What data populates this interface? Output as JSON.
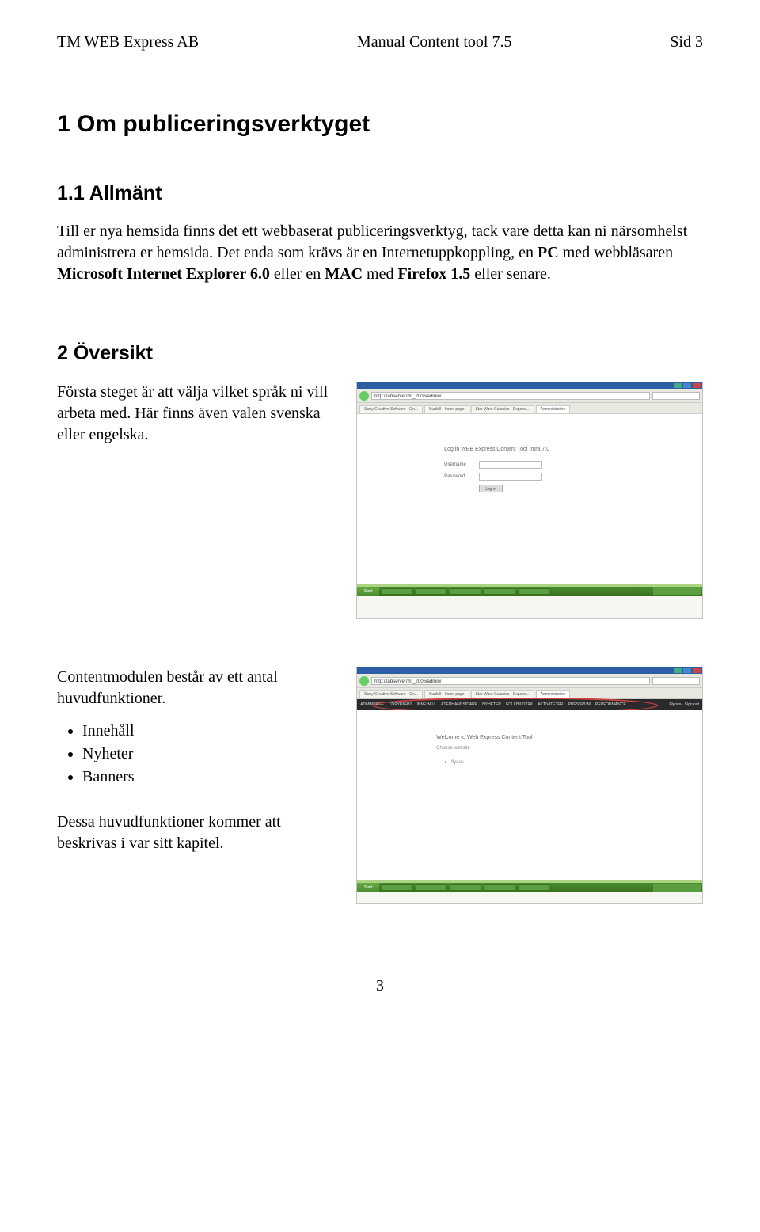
{
  "header": {
    "company": "TM WEB Express AB",
    "doc_title": "Manual Content tool 7.5",
    "page_label": "Sid 3"
  },
  "h1": "1 Om publiceringsverktyget",
  "section1": {
    "title": "1.1 Allmänt",
    "para": "Till er nya hemsida finns det ett webbaserat publiceringsverktyg, tack vare detta kan ni närsomhelst administrera er hemsida. Det enda som krävs är en Internetuppkoppling, en PC med webbläsaren Microsoft Internet Explorer 6.0 eller en MAC med Firefox 1.5 eller senare."
  },
  "section2": {
    "title": "2 Översikt",
    "para": "Första steget är att välja vilket språk ni vill arbeta med. Här finns även valen svenska eller engelska.",
    "screenshot": {
      "url": "http://labserver/mf_2006/admin/",
      "tabs": [
        "Sony Creative Software - On...",
        "Sunfall • Index page",
        "Star Wars Galaxies - Expans...",
        "Administration"
      ],
      "login_title": "Log in WEB Express Content Tool Intra 7.0",
      "username_label": "Username",
      "password_label": "Password",
      "login_button": "Log in",
      "start": "Start"
    }
  },
  "section3": {
    "para1": "Contentmodulen består av ett antal huvudfunktioner.",
    "funcs": [
      "Innehåll",
      "Nyheter",
      "Banners"
    ],
    "para2": "Dessa huvudfunktioner kommer att beskrivas i var sitt kapitel.",
    "screenshot": {
      "admin_menu": [
        "ADMINPAGE",
        "COPYRIGHT",
        "INNEHÅLL",
        "ÅTERHANDSIDARE",
        "NYHETER",
        "FOLKBILOTEK",
        "AKTIVITETER",
        "PRESSRUM",
        "PERFORMANCE"
      ],
      "admin_right": "Flyous · Sign out",
      "welcome": "Welcome to Web Express Content Tool",
      "welcome_sub": "Choose website",
      "welcome_item": "flyous"
    }
  },
  "footer_page": "3"
}
